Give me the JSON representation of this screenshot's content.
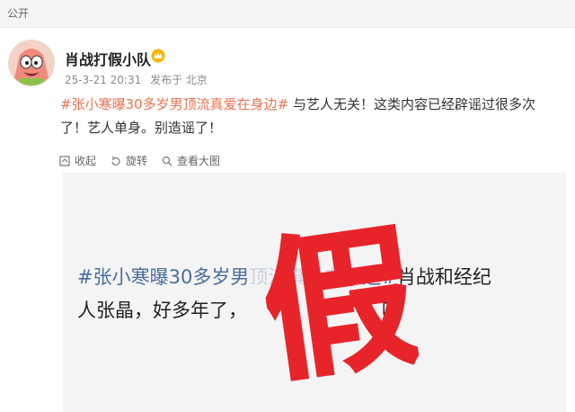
{
  "header": {
    "visibility": "公开"
  },
  "post": {
    "author": "肖战打假小队",
    "time": "25-3-21 20:31",
    "source": "发布于 北京",
    "hashtag": "#张小寒曝30多岁男顶流真爱在身边#",
    "body": " 与艺人无关！这类内容已经辟谣过很多次了！艺人单身。别造谣了！",
    "actions": {
      "favorite": "收起",
      "rotate": "旋转",
      "view_large": "查看大图"
    }
  },
  "image": {
    "hashtag": "#张小寒曝30多岁男",
    "hidden_part": "顶流真爱在身",
    "hashtag_end": "边#",
    "text_line1_end": "肖战和经纪",
    "text_line2_start": "人张晶，好多年了，",
    "text_line2_end": "呢",
    "stamp_char": "假",
    "stamp_color": "#e8242b"
  }
}
